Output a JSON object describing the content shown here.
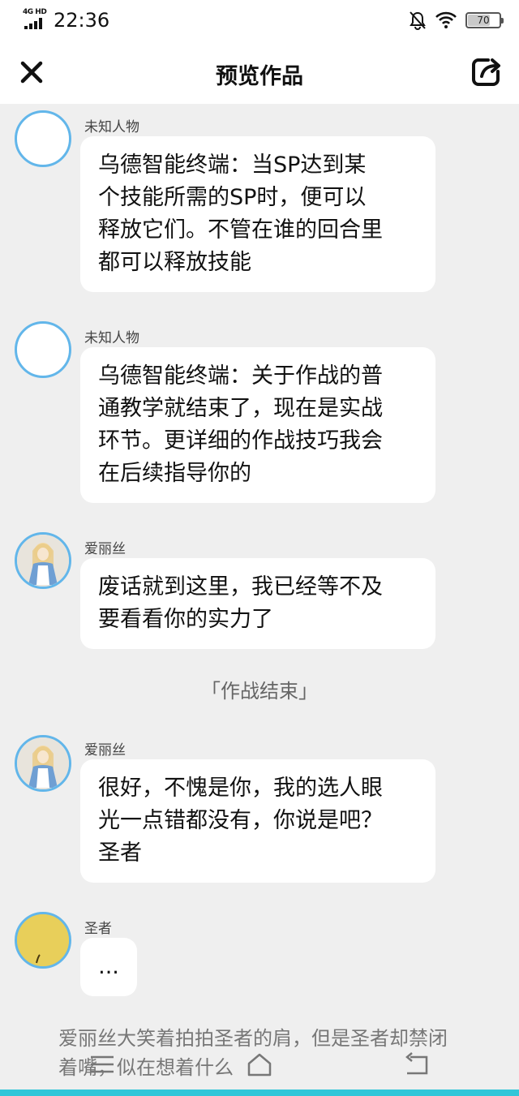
{
  "status": {
    "network": "4G HD",
    "time": "22:36",
    "battery": "70",
    "battery_level": 0.7
  },
  "header": {
    "title": "预览作品",
    "close_icon": "close-icon",
    "share_icon": "share-icon"
  },
  "messages": [
    {
      "speaker": "未知人物",
      "avatar": "blank",
      "text": "乌德智能终端：当SP达到某\n个技能所需的SP时，便可以\n释放它们。不管在谁的回合里\n都可以释放技能"
    },
    {
      "speaker": "未知人物",
      "avatar": "blank",
      "text": "乌德智能终端：关于作战的普\n通教学就结束了，现在是实战\n环节。更详细的作战技巧我会\n在后续指导你的"
    },
    {
      "speaker": "爱丽丝",
      "avatar": "character",
      "text": "废话就到这里，我已经等不及\n要看看你的实力了"
    },
    {
      "divider": "「作战结束」"
    },
    {
      "speaker": "爱丽丝",
      "avatar": "character",
      "text": "很好，不愧是你，我的选人眼\n光一点错都没有，你说是吧？\n圣者"
    },
    {
      "speaker": "圣者",
      "avatar": "yellow",
      "text": "..."
    }
  ],
  "narration": "爱丽丝大笑着拍拍圣者的肩，但是圣者却禁闭着嘴，似在想着什么",
  "system_nav": {
    "menu_icon": "menu-icon",
    "home_icon": "home-icon",
    "back_icon": "back-icon"
  },
  "colors": {
    "accent_border": "#62b6ea",
    "background": "#efefef",
    "bubble": "#ffffff",
    "bottom_strip": "#31c6d8"
  }
}
